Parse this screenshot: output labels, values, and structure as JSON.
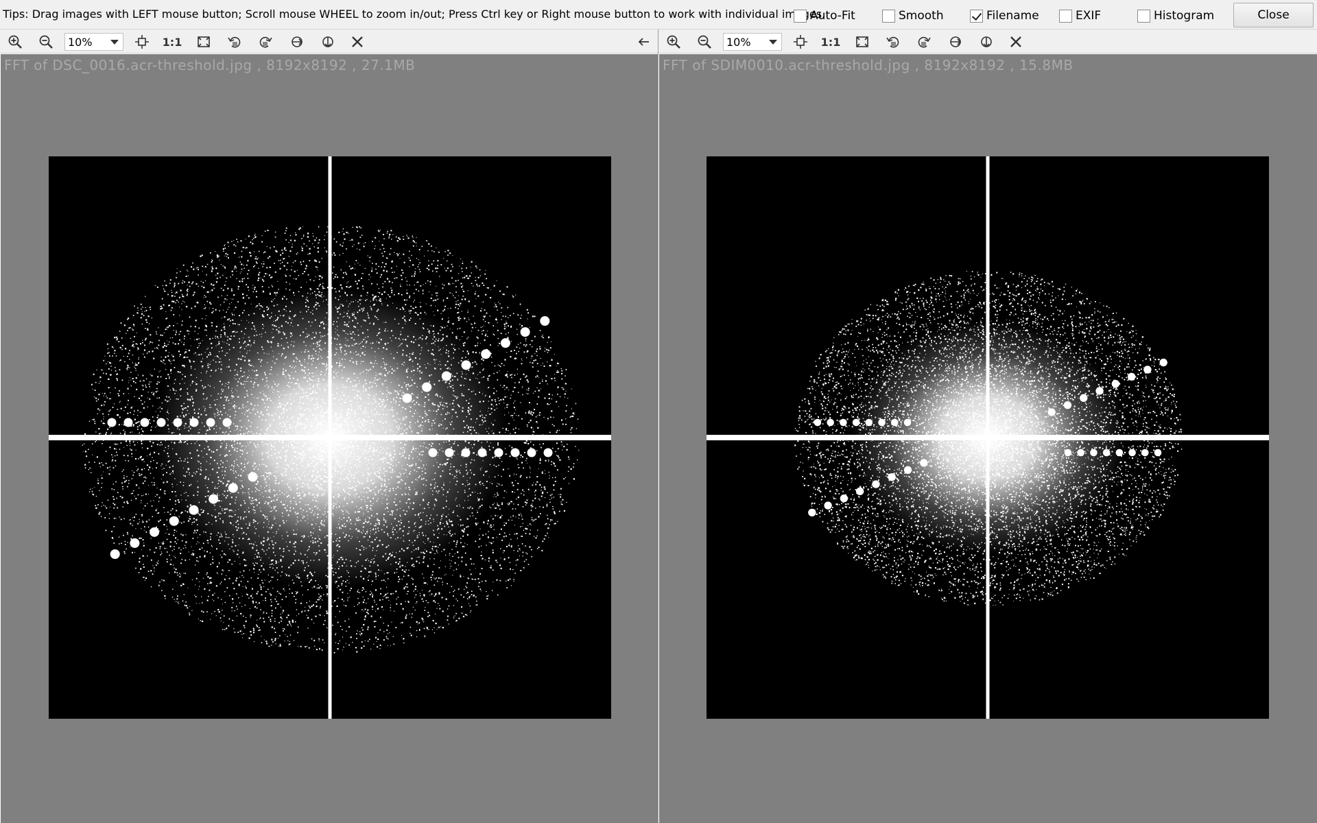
{
  "topbar": {
    "tips": "Tips: Drag images with LEFT mouse button; Scroll mouse WHEEL to zoom in/out; Press Ctrl key or Right mouse button to work with individual images.",
    "options": [
      {
        "label": "Auto-Fit",
        "checked": false
      },
      {
        "label": "Smooth",
        "checked": false
      },
      {
        "label": "Filename",
        "checked": true
      },
      {
        "label": "EXIF",
        "checked": false
      },
      {
        "label": "Histogram",
        "checked": false
      }
    ],
    "close_label": "Close"
  },
  "panes": [
    {
      "zoom": "10%",
      "one_to_one": "1:1",
      "caption": "FFT of DSC_0016.acr-threshold.jpg  ,  8192x8192  ,  27.1MB",
      "spectrum": {
        "spread": 1.0,
        "streak_angle_deg": -27
      }
    },
    {
      "zoom": "10%",
      "one_to_one": "1:1",
      "caption": "FFT of SDIM0010.acr-threshold.jpg  ,  8192x8192  ,  15.8MB",
      "spectrum": {
        "spread": 0.78,
        "streak_angle_deg": -22
      }
    }
  ],
  "icons": [
    "zoom-in-icon",
    "zoom-out-icon",
    "fit-icon",
    "actual-size-icon",
    "fullscreen-icon",
    "rotate-left-icon",
    "rotate-right-icon",
    "flip-horizontal-icon",
    "flip-vertical-icon",
    "close-icon",
    "sync-arrow-icon"
  ],
  "colors": {
    "background": "#808080",
    "image": "#000000",
    "spectrum": "#ffffff",
    "caption": "#a9a9a9"
  }
}
